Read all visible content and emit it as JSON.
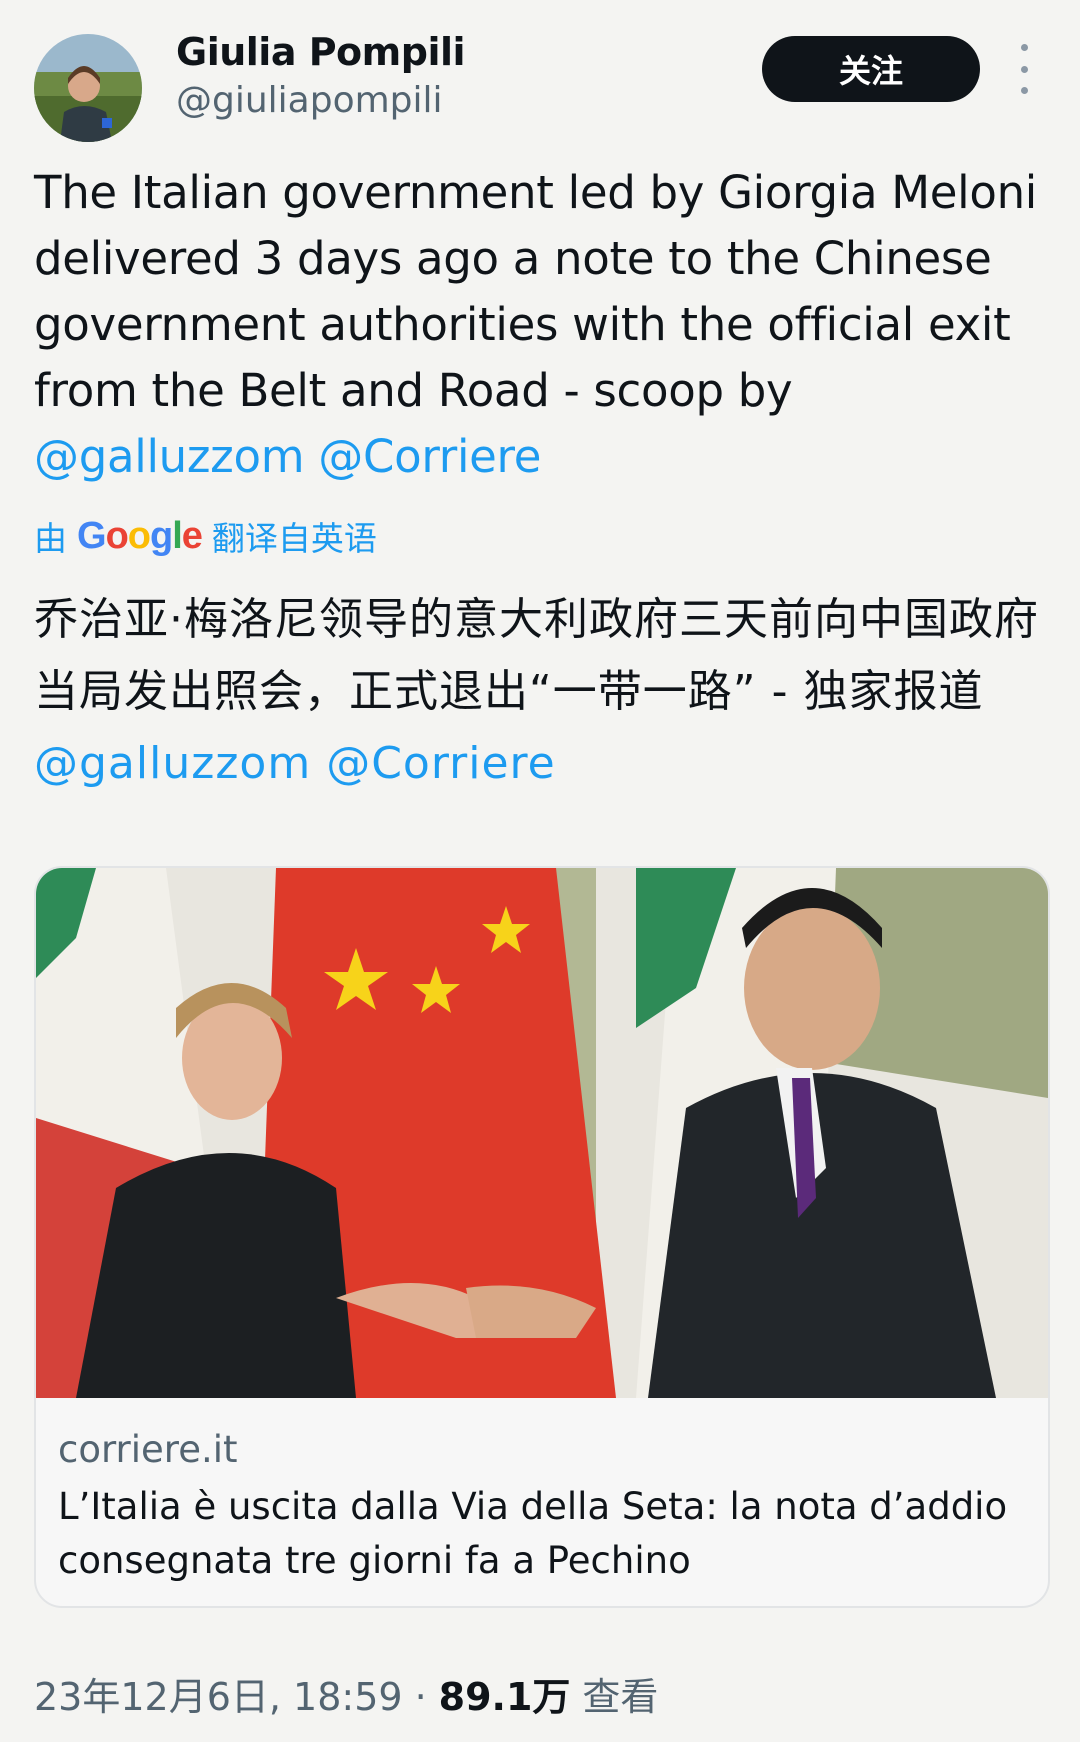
{
  "author": {
    "name": "Giulia Pompili",
    "handle": "@giuliapompili"
  },
  "follow_label": "关注",
  "more_icon": "more-vertical-icon",
  "tweet": {
    "text_main": "The Italian government led by Giorgia Meloni delivered 3 days ago a note to the Chinese government authorities with the official exit from the Belt and Road - scoop by ",
    "mention_1": "@galluzzom",
    "mention_2": "@Corriere"
  },
  "translation": {
    "prefix": "由",
    "google_letters": [
      "G",
      "o",
      "o",
      "g",
      "l",
      "e"
    ],
    "suffix": "翻译自英语",
    "text": "乔治亚·梅洛尼领导的意大利政府三天前向中国政府当局发出照会，正式退出“一带一路” - 独家报道",
    "mention_1": "@galluzzom",
    "mention_2": "@Corriere"
  },
  "link_card": {
    "domain": "corriere.it",
    "title": "L’Italia è uscita dalla Via della Seta: la nota d’addio consegnata tre giorni fa a Pechino"
  },
  "meta": {
    "datetime": "23年12月6日, 18:59",
    "separator": "·",
    "views_count": "89.1万",
    "views_label": "查看"
  },
  "colors": {
    "link_blue": "#1d9bf0",
    "text_primary": "#0f1419",
    "text_secondary": "#536471",
    "background": "#f4f4f2"
  }
}
